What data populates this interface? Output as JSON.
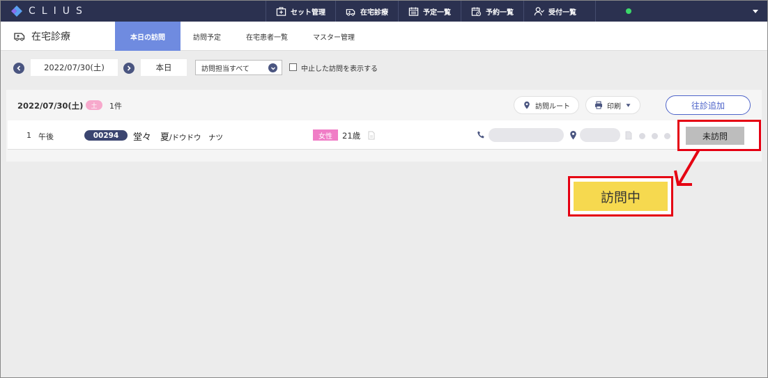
{
  "app": {
    "logo_text": "CLIUS"
  },
  "topnav": [
    {
      "label": "セット管理",
      "icon": "medical-kit-icon"
    },
    {
      "label": "在宅診療",
      "icon": "ambulance-icon"
    },
    {
      "label": "予定一覧",
      "icon": "schedule-icon"
    },
    {
      "label": "予約一覧",
      "icon": "calendar-clock-icon"
    },
    {
      "label": "受付一覧",
      "icon": "reception-person-icon"
    }
  ],
  "colors": {
    "topbar": "#2b3150",
    "tab_active": "#6f8be0",
    "accent": "#4d63c9",
    "female_badge": "#f07dc6",
    "status_online": "#3cd86a",
    "highlight": "#e50012",
    "visiting": "#f6d94f"
  },
  "header": {
    "section_title": "在宅診療",
    "tabs": [
      "本日の訪問",
      "訪問予定",
      "在宅患者一覧",
      "マスター管理"
    ]
  },
  "filter": {
    "date": "2022/07/30(土)",
    "today_label": "本日",
    "staff_select": "訪問担当すべて",
    "show_cancelled_label": "中止した訪問を表示する"
  },
  "panel": {
    "date": "2022/07/30(土)",
    "day_badge": "土",
    "count": "1件",
    "route_label": "訪問ルート",
    "print_label": "印刷",
    "add_label": "往診追加"
  },
  "row": {
    "num": "1",
    "time": "午後",
    "patient_id": "00294",
    "name": "堂々　夏",
    "kana": "/ドウドウ　ナツ",
    "sex": "女性",
    "age": "21歳",
    "status": "未訪問"
  },
  "callout": {
    "label": "訪問中"
  }
}
